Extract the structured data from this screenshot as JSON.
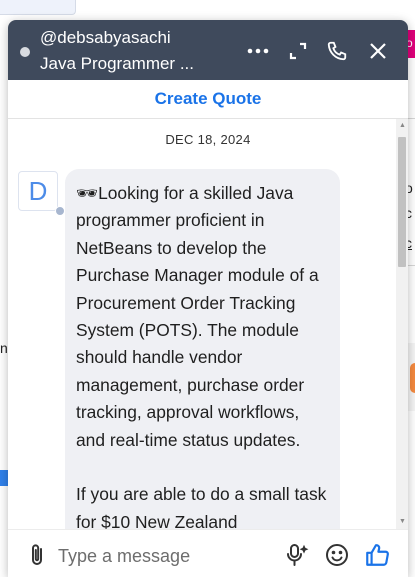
{
  "background": {
    "pink_tab_char": "o",
    "right_fragments": [
      "o",
      "c",
      "c"
    ],
    "left_fragments": [
      "n"
    ],
    "right_dot": "."
  },
  "chat": {
    "header": {
      "name": "@debsabyasachi",
      "subtitle": "Java Programmer ...",
      "icons": [
        "more-icon",
        "expand-icon",
        "phone-icon",
        "close-icon"
      ]
    },
    "quote_button": "Create Quote",
    "date_divider": "DEC 18, 2024",
    "sender_initial": "D",
    "message": {
      "emoji": "🕶",
      "paragraph1": "Looking for a skilled Java programmer proficient in NetBeans to develop the Purchase Manager module of a Procurement Order Tracking System (POTS). The module should handle vendor management, purchase order tracking, approval workflows, and real-time status updates.",
      "paragraph2": "If you are able to do a small task for $10 New Zealand"
    },
    "composer": {
      "placeholder": "Type a message",
      "icons": [
        "paperclip-icon",
        "voice-input-icon",
        "emoji-icon",
        "thumbs-up-icon"
      ]
    }
  },
  "colors": {
    "header_bg": "#3f4a5c",
    "accent": "#1a73e8",
    "bubble_bg": "#eff0f4"
  }
}
